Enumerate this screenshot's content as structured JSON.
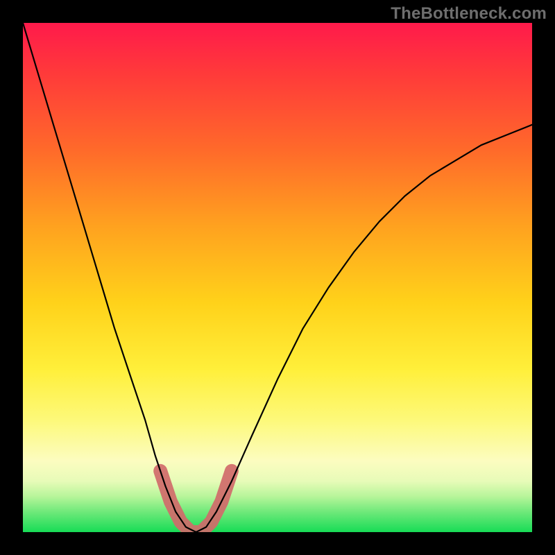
{
  "watermark": "TheBottleneck.com",
  "chart_data": {
    "type": "line",
    "title": "",
    "xlabel": "",
    "ylabel": "",
    "xlim": [
      0,
      100
    ],
    "ylim": [
      0,
      100
    ],
    "grid": false,
    "legend": false,
    "series": [
      {
        "name": "bottleneck-curve",
        "x": [
          0,
          3,
          6,
          9,
          12,
          15,
          18,
          21,
          24,
          26,
          28,
          30,
          32,
          34,
          36,
          38,
          41,
          45,
          50,
          55,
          60,
          65,
          70,
          75,
          80,
          85,
          90,
          95,
          100
        ],
        "values": [
          100,
          90,
          80,
          70,
          60,
          50,
          40,
          31,
          22,
          15,
          9,
          4,
          1,
          0,
          1,
          4,
          10,
          19,
          30,
          40,
          48,
          55,
          61,
          66,
          70,
          73,
          76,
          78,
          80
        ]
      }
    ],
    "annotations": [
      {
        "name": "minimum-highlight",
        "type": "segment",
        "x": [
          27,
          29,
          31,
          33,
          35,
          37,
          39,
          41
        ],
        "values": [
          12,
          6,
          2,
          0,
          0,
          2,
          6,
          12
        ]
      }
    ],
    "background_gradient_stops": [
      {
        "pct": 0,
        "color": "#ff1a4b"
      },
      {
        "pct": 10,
        "color": "#ff3a3a"
      },
      {
        "pct": 25,
        "color": "#ff6a2a"
      },
      {
        "pct": 40,
        "color": "#ffa21f"
      },
      {
        "pct": 55,
        "color": "#ffd21a"
      },
      {
        "pct": 68,
        "color": "#ffef3a"
      },
      {
        "pct": 78,
        "color": "#fdf97a"
      },
      {
        "pct": 86,
        "color": "#fcfcc0"
      },
      {
        "pct": 90,
        "color": "#e7fbb8"
      },
      {
        "pct": 93,
        "color": "#b7f59a"
      },
      {
        "pct": 96,
        "color": "#6fe97a"
      },
      {
        "pct": 100,
        "color": "#17dc56"
      }
    ]
  }
}
